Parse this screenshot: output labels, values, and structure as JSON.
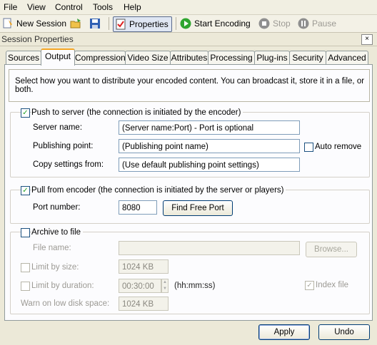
{
  "menu": [
    "File",
    "View",
    "Control",
    "Tools",
    "Help"
  ],
  "toolbar": {
    "new_session": "New Session",
    "properties": "Properties",
    "start_encoding": "Start Encoding",
    "stop": "Stop",
    "pause": "Pause"
  },
  "panel_title": "Session Properties",
  "close_glyph": "×",
  "tabs": [
    "Sources",
    "Output",
    "Compression",
    "Video Size",
    "Attributes",
    "Processing",
    "Plug-ins",
    "Security",
    "Advanced"
  ],
  "active_tab": "Output",
  "description": "Select how you want to distribute your encoded content. You can broadcast it, store it in a file, or both.",
  "push": {
    "label": "Push to server (the connection is initiated by the encoder)",
    "checked": true,
    "server_name_label": "Server name:",
    "server_name_value": "(Server name:Port)  - Port is optional",
    "publishing_point_label": "Publishing point:",
    "publishing_point_value": "(Publishing point name)",
    "auto_remove_label": "Auto remove",
    "copy_settings_label": "Copy settings from:",
    "copy_settings_value": "(Use default publishing point settings)"
  },
  "pull": {
    "label": "Pull from encoder (the connection is initiated by the server or players)",
    "checked": true,
    "port_label": "Port number:",
    "port_value": "8080",
    "find_port_button": "Find Free Port"
  },
  "archive": {
    "label": "Archive to file",
    "checked": false,
    "file_name_label": "File name:",
    "file_name_value": "",
    "browse_button": "Browse...",
    "limit_size_label": "Limit by size:",
    "limit_size_value": "1024 KB",
    "limit_duration_label": "Limit by duration:",
    "limit_duration_value": "00:30:00",
    "duration_format": "(hh:mm:ss)",
    "index_file_label": "Index file",
    "warn_label": "Warn on low disk space:",
    "warn_value": "1024 KB"
  },
  "footer": {
    "apply": "Apply",
    "undo": "Undo"
  },
  "check_glyph": "✓",
  "colors": {
    "accent_tab": "#f5a623",
    "check": "#21a121",
    "start_icon": "#2fa52f"
  }
}
